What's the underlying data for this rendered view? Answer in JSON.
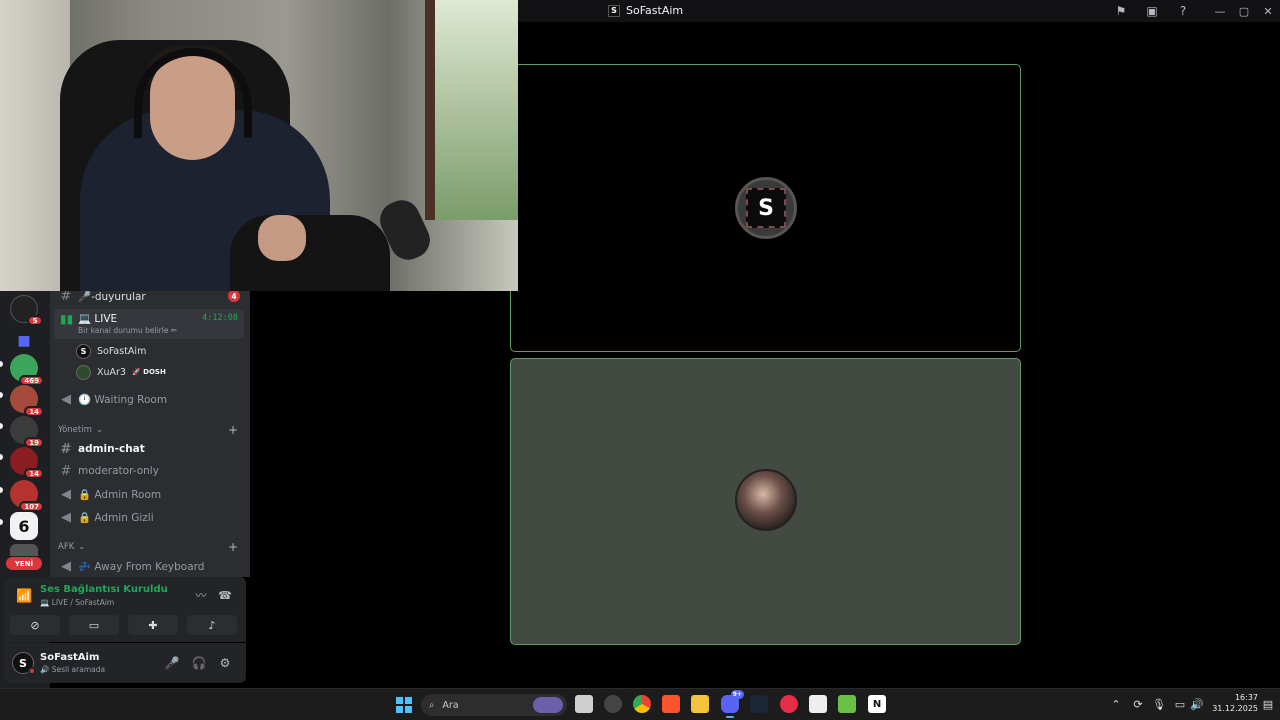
{
  "titlebar": {
    "app_name": "SoFastAim",
    "app_logo_letter": "S",
    "icons": [
      "flag-icon",
      "inbox-icon",
      "help-icon"
    ],
    "controls": [
      "minimize",
      "maximize",
      "close"
    ]
  },
  "rail": {
    "servers": [
      {
        "name": "creators-server",
        "badge": "5"
      },
      {
        "name": "dm-folder",
        "badge": ""
      },
      {
        "name": "server-3",
        "badge": "469"
      },
      {
        "name": "server-4",
        "badge": "14"
      },
      {
        "name": "server-5",
        "badge": "19"
      },
      {
        "name": "server-6",
        "badge": "14"
      },
      {
        "name": "server-7",
        "badge": "107"
      },
      {
        "name": "rainbow-six-server",
        "badge": ""
      },
      {
        "name": "pcs-server",
        "badge": ""
      }
    ],
    "new_label": "YENİ"
  },
  "channels": {
    "announcements": {
      "name": "🎤-duyurular",
      "badge": "4"
    },
    "live": {
      "name": "💻 LIVE",
      "status": "Bir kanal durumu belirle ✏",
      "timer": "4:12:08"
    },
    "voice_users": [
      {
        "name": "SoFastAim",
        "tag": ""
      },
      {
        "name": "XuAr3",
        "tag": "🚀 DOSH"
      }
    ],
    "waiting_room": "🕛 Waiting Room",
    "category_yonetim": "Yönetim",
    "admin_chat": "admin-chat",
    "moderator_only": "moderator-only",
    "admin_room": "🔒 Admin Room",
    "admin_gizli": "🔒 Admin Gizli",
    "category_afk": "AFK",
    "away": "💤 Away From Keyboard"
  },
  "voice_panel": {
    "status": "Ses Bağlantısı Kuruldu",
    "channel": "💻 LIVE / SoFastAim"
  },
  "user": {
    "name": "SoFastAim",
    "status": "🔊 Sesli aramada"
  },
  "stage": {
    "tile1_letter": "S"
  },
  "taskbar": {
    "search_placeholder": "Ara",
    "discord_badge": "9+",
    "time": "16:37",
    "date": "31.12.2025"
  },
  "colors": {
    "accent_green": "#23a559",
    "badge_red": "#da373c",
    "tile_border": "#5b9a63",
    "tile2_bg": "#424a42"
  }
}
